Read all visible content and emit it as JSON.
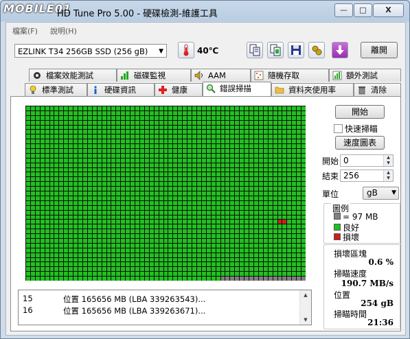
{
  "window": {
    "logo_text": "MOBILE01",
    "title": "HD Tune Pro 5.00 - 硬碟檢測-維護工具",
    "min_label": "—",
    "max_label": "□",
    "close_label": "X"
  },
  "menu": {
    "items": [
      {
        "label": "檔案(F)"
      },
      {
        "label": "說明(H)"
      }
    ]
  },
  "toolbar": {
    "drive": "EZLINK T34 256GB SSD (256 gB)",
    "temperature": "40℃",
    "exit_label": "離開"
  },
  "tabs_top": [
    {
      "label": "檔案效能測試",
      "icon": "file-benchmark-icon"
    },
    {
      "label": "磁碟監視",
      "icon": "disk-monitor-icon"
    },
    {
      "label": "AAM",
      "icon": "speaker-icon"
    },
    {
      "label": "隨機存取",
      "icon": "random-access-icon"
    },
    {
      "label": "額外測試",
      "icon": "extra-tests-icon"
    }
  ],
  "tabs_bottom": [
    {
      "label": "標準測試",
      "icon": "lightbulb-icon"
    },
    {
      "label": "硬碟資訊",
      "icon": "info-icon"
    },
    {
      "label": "健康",
      "icon": "health-cross-icon"
    },
    {
      "label": "錯誤掃描",
      "icon": "magnifier-icon",
      "active": true
    },
    {
      "label": "資料夾使用率",
      "icon": "folder-icon"
    },
    {
      "label": "清除",
      "icon": "trash-icon"
    }
  ],
  "scan": {
    "start_label": "開始",
    "quick_scan_label": "快速掃瞄",
    "speed_map_label": "速度圖表",
    "start_field_label": "開始",
    "start_value": "0",
    "end_field_label": "結束",
    "end_value": "256",
    "unit_label": "單位",
    "unit_value": "gB",
    "block_map": {
      "columns": 59,
      "rows": 37,
      "bad_block_row": 24,
      "bad_block_columns": [
        53,
        54
      ],
      "unscanned_row": 36,
      "unscanned_from_column": 41
    }
  },
  "legend": {
    "title": "圖例",
    "items": [
      {
        "label": "= 97 MB",
        "color": "#808080"
      },
      {
        "label": "良好",
        "color": "#22c020"
      },
      {
        "label": "損壞",
        "color": "#cc1f1f"
      }
    ]
  },
  "stats": {
    "damaged_label": "損壞區塊",
    "damaged_value": "0.6 %",
    "speed_label": "掃瞄速度",
    "speed_value": "190.7 MB/s",
    "position_label": "位置",
    "position_value": "254 gB",
    "time_label": "掃瞄時間",
    "time_value": "21:36"
  },
  "log": [
    {
      "num": "15",
      "msg": "位置 165656 MB (LBA 339263543)..."
    },
    {
      "num": "16",
      "msg": "位置 165656 MB (LBA 339263671)..."
    }
  ],
  "colors": {
    "good": "#22c020",
    "bad": "#cc1f1f",
    "unscanned": "#808080",
    "grid_line": "#0f0f0f"
  }
}
